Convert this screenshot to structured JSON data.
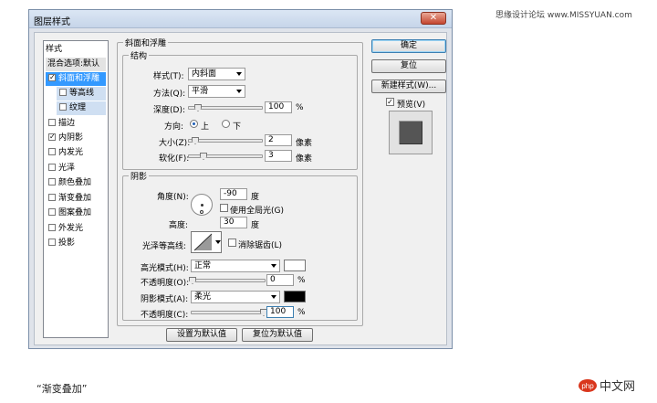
{
  "watermark": "思缘设计论坛 www.MISSYUAN.com",
  "dialog": {
    "title": "图层样式",
    "close_icon": "close-icon"
  },
  "sidebar": {
    "header": "样式",
    "items": [
      {
        "label": "混合选项:默认",
        "checked": null
      },
      {
        "label": "斜面和浮雕",
        "checked": true
      },
      {
        "label": "等高线",
        "checked": false
      },
      {
        "label": "纹理",
        "checked": false
      },
      {
        "label": "描边",
        "checked": false
      },
      {
        "label": "内阴影",
        "checked": true
      },
      {
        "label": "内发光",
        "checked": false
      },
      {
        "label": "光泽",
        "checked": false
      },
      {
        "label": "颜色叠加",
        "checked": false
      },
      {
        "label": "渐变叠加",
        "checked": false
      },
      {
        "label": "图案叠加",
        "checked": false
      },
      {
        "label": "外发光",
        "checked": false
      },
      {
        "label": "投影",
        "checked": false
      }
    ]
  },
  "main": {
    "group_title": "斜面和浮雕",
    "structure": {
      "title": "结构",
      "style_label": "样式(T):",
      "style_value": "内斜面",
      "method_label": "方法(Q):",
      "method_value": "平滑",
      "depth_label": "深度(D):",
      "depth_value": "100",
      "depth_unit": "%",
      "depth_level": 1.0,
      "direction_label": "方向:",
      "direction_up": "上",
      "direction_down": "下",
      "direction_selected": "上",
      "size_label": "大小(Z):",
      "size_value": "2",
      "size_unit": "像素",
      "soften_label": "软化(F):",
      "soften_value": "3",
      "soften_unit": "像素"
    },
    "shading": {
      "title": "阴影",
      "angle_label": "角度(N):",
      "angle_value": "-90",
      "angle_unit": "度",
      "global_light_label": "使用全局光(G)",
      "global_light_checked": false,
      "altitude_label": "高度:",
      "altitude_value": "30",
      "altitude_unit": "度",
      "gloss_label": "光泽等高线:",
      "antialias_label": "消除锯齿(L)",
      "antialias_checked": false,
      "highlight_mode_label": "高光模式(H):",
      "highlight_mode_value": "正常",
      "highlight_color": "#ffffff",
      "highlight_opacity_label": "不透明度(O):",
      "highlight_opacity_value": "0",
      "highlight_opacity_unit": "%",
      "shadow_mode_label": "阴影模式(A):",
      "shadow_mode_value": "柔光",
      "shadow_color": "#000000",
      "shadow_opacity_label": "不透明度(C):",
      "shadow_opacity_value": "100",
      "shadow_opacity_unit": "%"
    },
    "make_default": "设置为默认值",
    "reset_default": "复位为默认值"
  },
  "right": {
    "ok": "确定",
    "reset": "复位",
    "new_style": "新建样式(W)...",
    "preview_label": "预览(V)",
    "preview_checked": true
  },
  "caption": "“渐变叠加”",
  "logo": "php中文网"
}
